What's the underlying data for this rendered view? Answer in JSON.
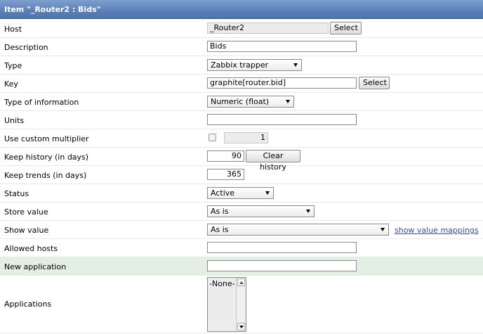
{
  "title": "Item \"_Router2 : Bids\"",
  "fields": {
    "host": {
      "label": "Host",
      "value": "_Router2",
      "button": "Select"
    },
    "description": {
      "label": "Description",
      "value": "Bids"
    },
    "type": {
      "label": "Type",
      "selected": "Zabbix trapper"
    },
    "key": {
      "label": "Key",
      "value": "graphite[router.bid]",
      "button": "Select"
    },
    "type_of_information": {
      "label": "Type of information",
      "selected": "Numeric (float)"
    },
    "units": {
      "label": "Units",
      "value": ""
    },
    "custom_multiplier": {
      "label": "Use custom multiplier",
      "checked": false,
      "value": "1"
    },
    "keep_history": {
      "label": "Keep history (in days)",
      "value": "90",
      "button": "Clear history"
    },
    "keep_trends": {
      "label": "Keep trends (in days)",
      "value": "365"
    },
    "status": {
      "label": "Status",
      "selected": "Active"
    },
    "store_value": {
      "label": "Store value",
      "selected": "As is"
    },
    "show_value": {
      "label": "Show value",
      "selected": "As is",
      "link": "show value mappings"
    },
    "allowed_hosts": {
      "label": "Allowed hosts",
      "value": ""
    },
    "new_application": {
      "label": "New application",
      "value": ""
    },
    "applications": {
      "label": "Applications",
      "options": [
        "-None-"
      ]
    }
  },
  "colors": {
    "title_bar": "#5b7fb7",
    "highlight_row": "#e2efe2",
    "link": "#3a4f9a"
  }
}
